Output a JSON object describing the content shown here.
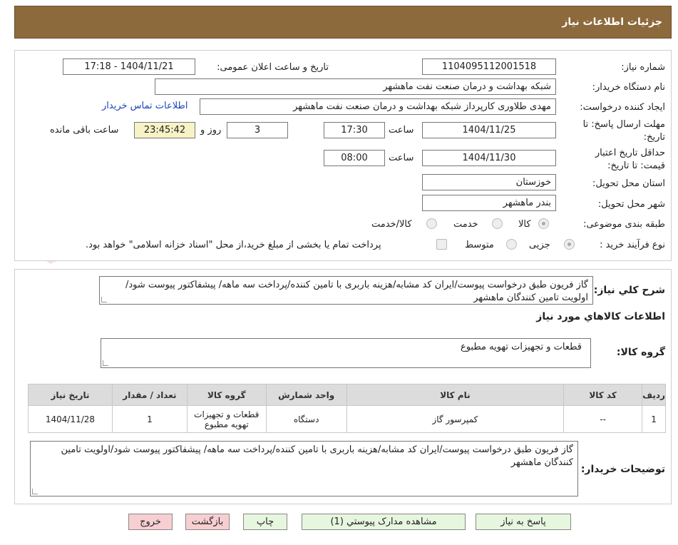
{
  "header": {
    "title": "جزئیات اطلاعات نیاز"
  },
  "form": {
    "need_number_label": "شماره نیاز:",
    "need_number": "1104095112001518",
    "announce_label": "تاریخ و ساعت اعلان عمومی:",
    "announce_value": "1404/11/21 - 17:18",
    "buyer_label": "نام دستگاه خریدار:",
    "buyer_value": "شبکه بهداشت و درمان صنعت نفت ماهشهر",
    "creator_label": "ایجاد کننده درخواست:",
    "creator_value": "مهدی طلاوری کارپرداز شبکه بهداشت و درمان صنعت نفت ماهشهر",
    "contact_link": "اطلاعات تماس خریدار",
    "deadline_label_1": "مهلت ارسال پاسخ: تا",
    "deadline_label_2": "تاریخ:",
    "deadline_date": "1404/11/25",
    "time_label": "ساعت",
    "deadline_time": "17:30",
    "days_value": "3",
    "days_label": "روز و",
    "remaining_time": "23:45:42",
    "remaining_label": "ساعت باقی مانده",
    "validity_label_1": "حداقل تاریخ اعتبار",
    "validity_label_2": "قیمت: تا تاریخ:",
    "validity_date": "1404/11/30",
    "validity_time": "08:00",
    "province_label": "استان محل تحویل:",
    "province_value": "خوزستان",
    "city_label": "شهر محل تحویل:",
    "city_value": "بندر ماهشهر",
    "category_label": "طبقه بندی موضوعی:",
    "category_options": [
      "کالا",
      "خدمت",
      "کالا/خدمت"
    ],
    "process_label": "نوع فرآیند خرید :",
    "process_options": [
      "جزیی",
      "متوسط"
    ],
    "payment_note": "پرداخت تمام یا بخشی از مبلغ خرید،از محل \"اسناد خزانه اسلامی\" خواهد بود."
  },
  "summary": {
    "label": "شرح کلي نياز:",
    "text": "گاز فریون طبق درخواست پیوست/ایران کد مشابه/هزینه باربری با تامین کننده/پرداخت سه ماهه/ پیشفاکتور پیوست شود/اولویت تامین کنندگان ماهشهر"
  },
  "goods": {
    "section_title": "اطلاعات کالاهاي مورد نياز",
    "group_label": "گروه کالا:",
    "group_value": "قطعات و تجهیزات تهویه مطبوع",
    "columns": [
      "رديف",
      "کد کالا",
      "نام کالا",
      "واحد شمارش",
      "گروه کالا",
      "تعداد / مقدار",
      "تاريخ نياز"
    ],
    "rows": [
      [
        "1",
        "--",
        "کمپرسور گاز",
        "دستگاه",
        "قطعات و تجهیزات تهویه مطبوع",
        "1",
        "1404/11/28"
      ]
    ]
  },
  "buyer_notes": {
    "label": "توضیحات خریدار:",
    "text": "گاز فریون طبق درخواست پیوست/ایران کد مشابه/هزینه باربری با تامین کننده/پرداخت سه ماهه/ پیشفاکتور پیوست شود/اولویت تامین کنندگان ماهشهر"
  },
  "buttons": {
    "reply": "پاسخ به نیاز",
    "attachments": "مشاهده مدارک پیوستي (1)",
    "print": "چاپ",
    "back": "بازگشت",
    "exit": "خروج"
  },
  "watermark": {
    "text": "AriaTender.neT"
  },
  "colors": {
    "header_bg": "#8c6a3c",
    "link": "#1a47b8",
    "btn_green": "#e7f6df",
    "btn_pink": "#f7cfd2",
    "remaining_bg": "#f7f3c6"
  }
}
